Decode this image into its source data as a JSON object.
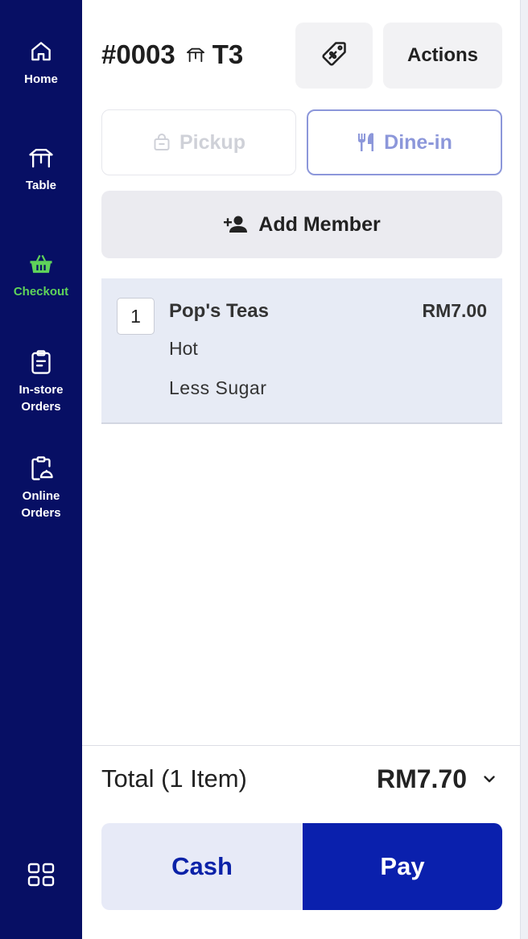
{
  "sidebar": {
    "items": [
      {
        "label": "Home",
        "icon": "home-icon"
      },
      {
        "label": "Table",
        "icon": "table-icon"
      },
      {
        "label": "Checkout",
        "icon": "basket-icon",
        "active": true
      },
      {
        "label": "In-store\nOrders",
        "icon": "clipboard-icon"
      },
      {
        "label": "Online\nOrders",
        "icon": "online-order-icon"
      }
    ],
    "menu_icon": "grid-icon"
  },
  "order": {
    "number": "#0003",
    "table": "T3",
    "table_icon": "table-icon"
  },
  "toolbar": {
    "discount_icon": "discount-tag-icon",
    "actions_label": "Actions"
  },
  "order_type": {
    "pickup_label": "Pickup",
    "dinein_label": "Dine-in",
    "selected": "Dine-in"
  },
  "member": {
    "add_label": "Add Member",
    "icon": "add-person-icon"
  },
  "cart": {
    "items": [
      {
        "qty": "1",
        "name": "Pop's Teas",
        "price": "RM7.00",
        "modifiers": [
          "Hot",
          "Less Sugar"
        ]
      }
    ]
  },
  "summary": {
    "total_label": "Total (1 Item)",
    "total_value": "RM7.70"
  },
  "payment": {
    "cash_label": "Cash",
    "pay_label": "Pay"
  },
  "colors": {
    "sidebar_bg": "#070f64",
    "active_nav": "#5fd35a",
    "primary": "#0a20ad",
    "dinein_accent": "#8c97da",
    "cart_item_bg": "#e7ebf5"
  }
}
